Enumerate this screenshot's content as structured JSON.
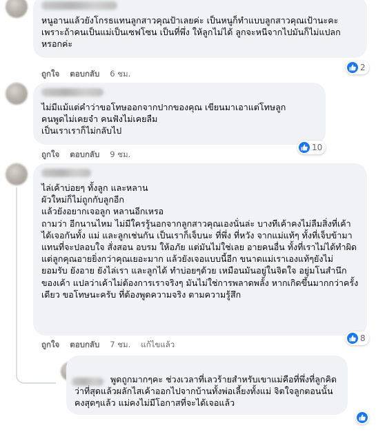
{
  "comments": [
    {
      "text": "หนูอานแล้วยังโกรธแทนลูกสาวคุณป้าเลยค่ะ เป็นหนูก็ทำแบบลูกสาวคุณเป้านะคะ เพราะถ้าคนเป็นแม่เป็นเซฟโซน เป็นที่พึ่ง ให้ลูกไม่ได้ ลูกจะหนีจากไปมันก็ไม่แปลกหรอกค่ะ",
      "like": "ถูกใจ",
      "reply": "ตอบกลับ",
      "time": "6 ชม.",
      "reactions": "2"
    },
    {
      "text": "ไม่มีแม้แต่คำว่าขอโทษออกจากปากของคุณ เขียนมาเอาแต่โทษลูก\nคนพูดไม่เคยจำ คนฟังไม่เคยลืม\nเป็นเราเราก็ไม่กลับไป",
      "like": "ถูกใจ",
      "reply": "ตอบกลับ",
      "time": "9 ชม.",
      "reactions": "10"
    },
    {
      "text": "ไล่เค้าบ่อยๆ ทั้งลูก และหลาน\nผัวใหม่ก็ไม่ถูกกับลูกอีก\nแล้วยังอยากเจอลูก หลานอีกเหรอ\nถามว่า อีกนานไหม ไม่มีใครรู้นอกจากลูกสาวคุณเองนั่นล่ะ บางทีเค้าคงไม่ลืมสิ่งที่เค้าได้เจอกันทั้ง แม่ และลูกเช่นกัน เป็นเราก็เจ็บนะ ที่พึ่ง ที่หวัง จากแม่แท้ๆ ทั้งที่เจ็บข้ามา แทนที่จะปลอบใจ สั่งสอน อบรม ให้อภัย แต่มันไม่ใช่เลย อายคนอื่น ทั้งที่เราไม่ได้ทำผิด แต่ลูกคุณอายยิ่งกว่าคุณเยอะมาก แล้วยังเจอแบบนี้อีก ขนาดแม่เราเองแท้ๆยังไม่ยอมรับ ยังอาย ยังไล่เรา และลูกได้ ทำบ่อยๆด้วย เหมือนมันอยู่ในจิตใจ อยู่มโนสำนึกของเค้า แปลว่าเค้าไม่ต้องการเราจริงๆ มันไม่ใช่การพลาดพลั้ง หากเกิดขึ้นมากกว่าครั้งเดียว ขอโทษนะครับ ที่ต้องพูดความจริง ตามความรู้สึก",
      "like": "ถูกใจ",
      "reply": "ตอบกลับ",
      "time": "7 ชม.",
      "edited": "แก้ไขแล้ว",
      "reactions": "8"
    }
  ],
  "reply_comment": {
    "text": "พูดถูกมากๆคะ ช่วงเวลาที่เลวร้ายสำหรับเขาแม่คือที่พึ่งที่ลูกคิดว่าที่สุดแล้วผลักไสเค้าออกไปจากบ้านทั้งพ่อเลี้ยงทั้งแม่ จิตใจลูกตอนนั้นคงสุดๆแล้ว แม่คงไม่มีโอกาสที่จะได้เจอแล้ว"
  },
  "colors": {
    "bubble": "#f0f2f5",
    "meta_text": "#65676b",
    "like_blue": "#1877f2"
  },
  "icons": {
    "reaction": "thumbs-up-icon"
  }
}
